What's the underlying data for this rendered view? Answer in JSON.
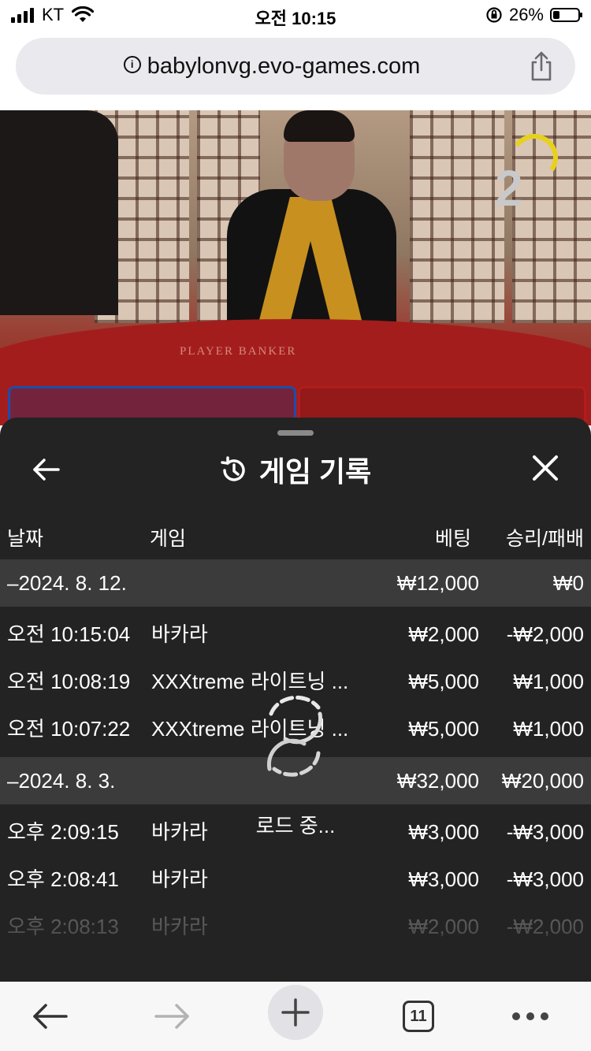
{
  "status_bar": {
    "carrier": "KT",
    "time": "오전 10:15",
    "battery_percent": "26%",
    "battery_level": 0.26,
    "icons": [
      "signal-icon",
      "wifi-icon",
      "orientation-lock-icon",
      "battery-icon"
    ]
  },
  "address_bar": {
    "url": "babylonvg.evo-games.com",
    "icons": [
      "info-icon",
      "share-icon"
    ]
  },
  "video": {
    "countdown": "2",
    "table_text": "PLAYER          BANKER"
  },
  "history": {
    "title": "게임 기록",
    "icons": [
      "back-arrow-icon",
      "history-icon",
      "close-icon"
    ],
    "columns": {
      "date": "날짜",
      "game": "게임",
      "bet": "베팅",
      "win_loss": "승리/패배"
    },
    "groups": [
      {
        "date": "–2024. 8. 12.",
        "bet": "₩12,000",
        "win_loss": "₩0",
        "rows": [
          {
            "time": "오전 10:15:04",
            "game": "바카라",
            "bet": "₩2,000",
            "win_loss": "-₩2,000"
          },
          {
            "time": "오전 10:08:19",
            "game": "XXXtreme 라이트닝 ...",
            "bet": "₩5,000",
            "win_loss": "₩1,000"
          },
          {
            "time": "오전 10:07:22",
            "game": "XXXtreme 라이트닝 ...",
            "bet": "₩5,000",
            "win_loss": "₩1,000"
          }
        ]
      },
      {
        "date": "–2024. 8. 3.",
        "bet": "₩32,000",
        "win_loss": "₩20,000",
        "rows": [
          {
            "time": "오후 2:09:15",
            "game": "바카라",
            "bet": "₩3,000",
            "win_loss": "-₩3,000"
          },
          {
            "time": "오후 2:08:41",
            "game": "바카라",
            "bet": "₩3,000",
            "win_loss": "-₩3,000"
          },
          {
            "time": "오후 2:08:13",
            "game": "바카라",
            "bet": "₩2,000",
            "win_loss": "-₩2,000"
          }
        ]
      }
    ],
    "loading_text": "로드 중..."
  },
  "toolbar": {
    "tab_count": "11",
    "icons": [
      "back-icon",
      "forward-icon",
      "new-tab-icon",
      "tabs-icon",
      "more-icon"
    ]
  }
}
